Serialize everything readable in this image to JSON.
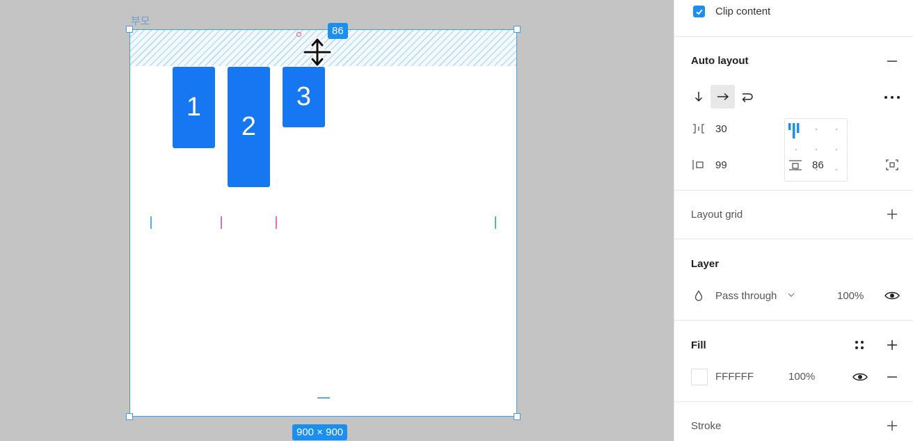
{
  "canvas": {
    "frame_name": "부모",
    "frame_size": "900 × 900",
    "padding_badge": "86",
    "children": [
      "1",
      "2",
      "3"
    ]
  },
  "panel": {
    "clip_content": {
      "label": "Clip content",
      "checked": true
    },
    "auto_layout": {
      "title": "Auto layout",
      "direction": "horizontal",
      "gap": "30",
      "padding_horizontal": "99",
      "padding_vertical": "86",
      "alignment": "top-left"
    },
    "layout_grid": {
      "title": "Layout grid"
    },
    "layer": {
      "title": "Layer",
      "blend_mode": "Pass through",
      "opacity": "100%"
    },
    "fill": {
      "title": "Fill",
      "hex": "FFFFFF",
      "opacity": "100%",
      "color": "#FFFFFF"
    },
    "stroke": {
      "title": "Stroke"
    }
  },
  "colors": {
    "accent": "#1b8ff0",
    "child_fill": "#1677f2",
    "selection": "#3d9cf0",
    "guide_pink": "#df6fb3"
  }
}
